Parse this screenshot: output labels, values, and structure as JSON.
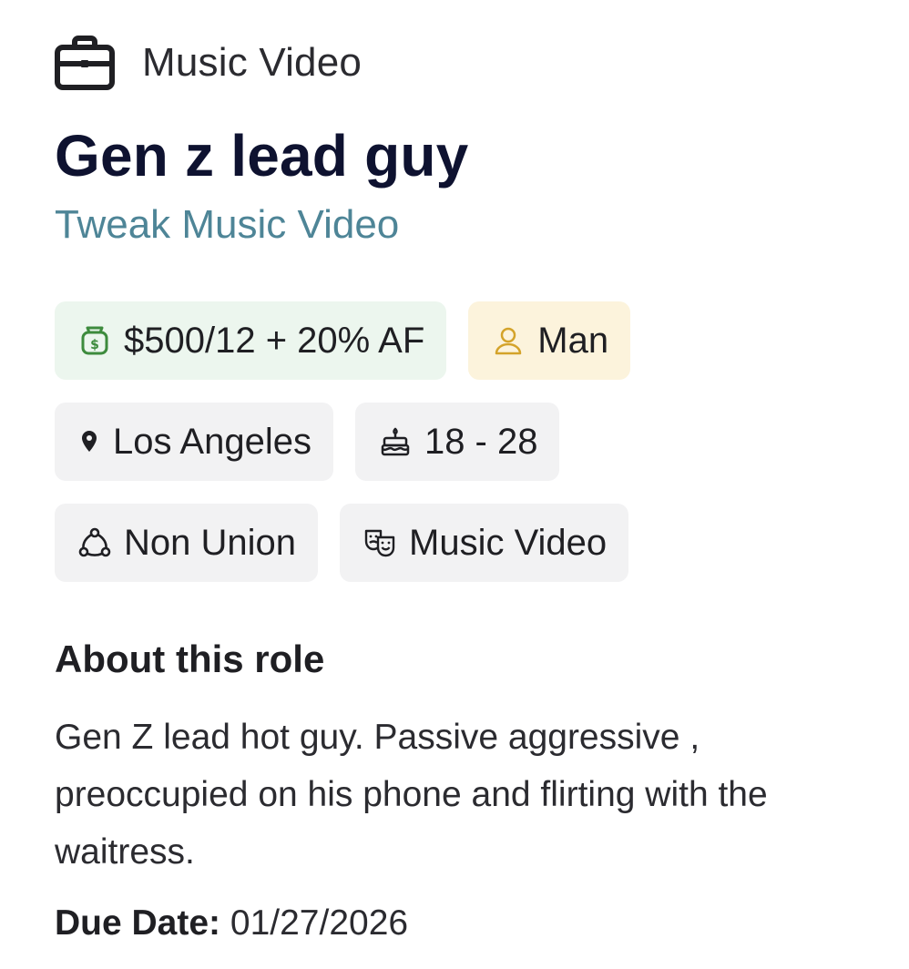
{
  "category": {
    "icon": "briefcase-icon",
    "label": "Music Video"
  },
  "role": {
    "title": "Gen z lead guy",
    "project": "Tweak Music Video"
  },
  "tags": {
    "pay": {
      "icon": "money-bag-icon",
      "label": "$500/12 + 20% AF",
      "color": "#ecf6ee"
    },
    "gender": {
      "icon": "person-icon",
      "label": "Man",
      "color": "#fcf3dc"
    },
    "location": {
      "icon": "map-pin-icon",
      "label": "Los Angeles"
    },
    "age": {
      "icon": "birthday-cake-icon",
      "label": "18 - 28"
    },
    "union": {
      "icon": "union-network-icon",
      "label": "Non Union"
    },
    "project_type": {
      "icon": "theater-masks-icon",
      "label": "Music Video"
    }
  },
  "about": {
    "heading": "About this role",
    "body": "Gen Z lead hot guy. Passive aggressive , preoccupied on his phone and flirting with the waitress."
  },
  "due": {
    "label": "Due Date:",
    "value": "01/27/2026"
  },
  "colors": {
    "title": "#0e1230",
    "project_link": "#4e8597",
    "pay_icon": "#3d8b3d",
    "gender_icon": "#d4a32a",
    "tag_background": "#f2f2f3"
  }
}
